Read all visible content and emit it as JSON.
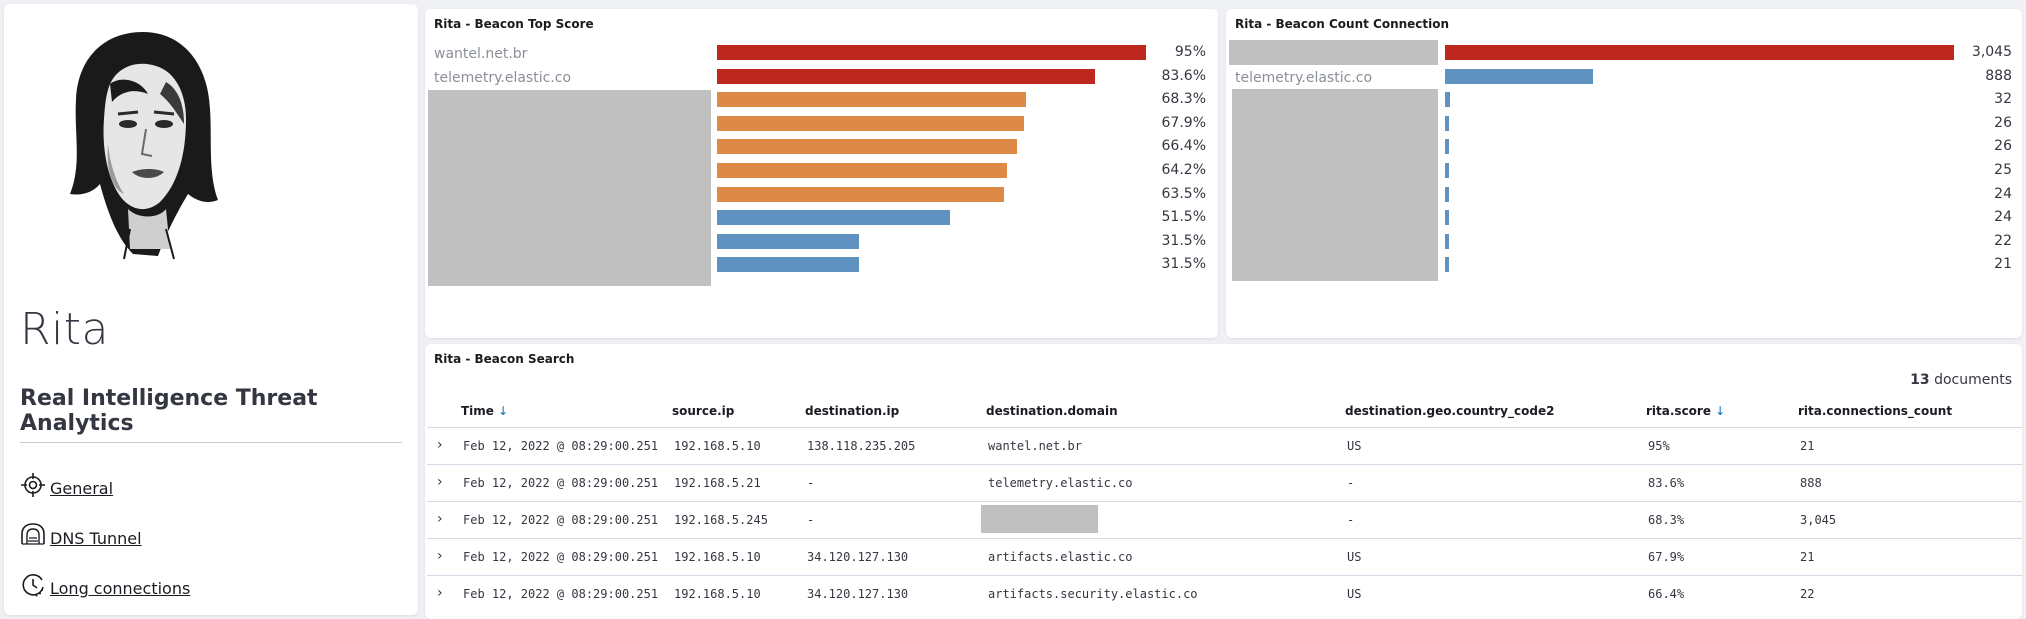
{
  "sidebar": {
    "title": "Rita",
    "subtitle": "Real Intelligence Threat Analytics",
    "nav": [
      {
        "label": "General",
        "icon": "crosshair-icon"
      },
      {
        "label": "DNS Tunnel",
        "icon": "tunnel-icon"
      },
      {
        "label": "Long connections",
        "icon": "clock-icon"
      }
    ]
  },
  "top_score": {
    "title": "Rita - Beacon Top Score",
    "labels": [
      "wantel.net.br",
      "telemetry.elastic.co"
    ]
  },
  "count_connection": {
    "title": "Rita - Beacon Count Connection",
    "labels": [
      "telemetry.elastic.co"
    ]
  },
  "chart_data": [
    {
      "type": "bar",
      "orientation": "horizontal",
      "title": "Rita - Beacon Top Score",
      "categories": [
        "wantel.net.br",
        "telemetry.elastic.co",
        "",
        "",
        "",
        "",
        "",
        "",
        "",
        ""
      ],
      "values": [
        95,
        83.6,
        68.3,
        67.9,
        66.4,
        64.2,
        63.5,
        51.5,
        31.5,
        31.5
      ],
      "value_labels": [
        "95%",
        "83.6%",
        "68.3%",
        "67.9%",
        "66.4%",
        "64.2%",
        "63.5%",
        "51.5%",
        "31.5%",
        "31.5%"
      ],
      "colors": [
        "#bd271e",
        "#bd271e",
        "#dd8a47",
        "#dd8a47",
        "#dd8a47",
        "#dd8a47",
        "#dd8a47",
        "#6092c0",
        "#6092c0",
        "#6092c0"
      ],
      "xlim": [
        0,
        100
      ]
    },
    {
      "type": "bar",
      "orientation": "horizontal",
      "title": "Rita - Beacon Count Connection",
      "categories": [
        "",
        "telemetry.elastic.co",
        "",
        "",
        "",
        "",
        "",
        "",
        "",
        ""
      ],
      "values": [
        3045,
        888,
        32,
        26,
        26,
        25,
        24,
        24,
        22,
        21
      ],
      "value_labels": [
        "3,045",
        "888",
        "32",
        "26",
        "26",
        "25",
        "24",
        "24",
        "22",
        "21"
      ],
      "colors": [
        "#bd271e",
        "#6092c0",
        "#6092c0",
        "#6092c0",
        "#6092c0",
        "#6092c0",
        "#6092c0",
        "#6092c0",
        "#6092c0",
        "#6092c0"
      ],
      "xlim": [
        0,
        3045
      ]
    }
  ],
  "search": {
    "title": "Rita - Beacon Search",
    "doc_count": "13",
    "doc_label": "documents",
    "columns": [
      "Time",
      "source.ip",
      "destination.ip",
      "destination.domain",
      "destination.geo.country_code2",
      "rita.score",
      "rita.connections_count"
    ],
    "sort_arrow": "↓",
    "expander": "›",
    "rows": [
      [
        "Feb 12, 2022 @ 08:29:00.251",
        "192.168.5.10",
        "138.118.235.205",
        "wantel.net.br",
        "US",
        "95%",
        "21"
      ],
      [
        "Feb 12, 2022 @ 08:29:00.251",
        "192.168.5.21",
        " -",
        "telemetry.elastic.co",
        " -",
        "83.6%",
        "888"
      ],
      [
        "Feb 12, 2022 @ 08:29:00.251",
        "192.168.5.245",
        " -",
        "",
        " -",
        "68.3%",
        "3,045"
      ],
      [
        "Feb 12, 2022 @ 08:29:00.251",
        "192.168.5.10",
        "34.120.127.130",
        "artifacts.elastic.co",
        "US",
        "67.9%",
        "21"
      ],
      [
        "Feb 12, 2022 @ 08:29:00.251",
        "192.168.5.10",
        "34.120.127.130",
        "artifacts.security.elastic.co",
        "US",
        "66.4%",
        "22"
      ]
    ]
  }
}
